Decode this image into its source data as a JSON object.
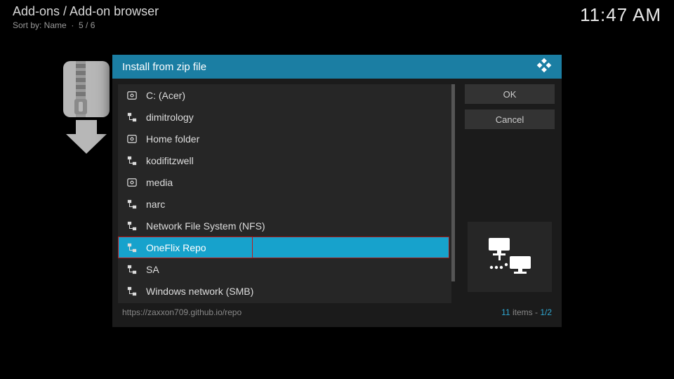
{
  "header": {
    "breadcrumb": "Add-ons / Add-on browser",
    "sort_label": "Sort by: Name",
    "sort_pos": "5 / 6",
    "clock": "11:47 AM"
  },
  "dialog": {
    "title": "Install from zip file",
    "items": [
      {
        "label": "C: (Acer)",
        "icon": "disk"
      },
      {
        "label": "dimitrology",
        "icon": "net"
      },
      {
        "label": "Home folder",
        "icon": "disk"
      },
      {
        "label": "kodifitzwell",
        "icon": "net"
      },
      {
        "label": "media",
        "icon": "disk"
      },
      {
        "label": "narc",
        "icon": "net"
      },
      {
        "label": "Network File System (NFS)",
        "icon": "net"
      },
      {
        "label": "OneFlix Repo",
        "icon": "net",
        "selected": true
      },
      {
        "label": "SA",
        "icon": "net"
      },
      {
        "label": "Windows network (SMB)",
        "icon": "net"
      }
    ],
    "ok_label": "OK",
    "cancel_label": "Cancel",
    "footer_path": "https://zaxxon709.github.io/repo",
    "footer_count": "11",
    "footer_items_word": "items",
    "footer_page": "1/2"
  }
}
